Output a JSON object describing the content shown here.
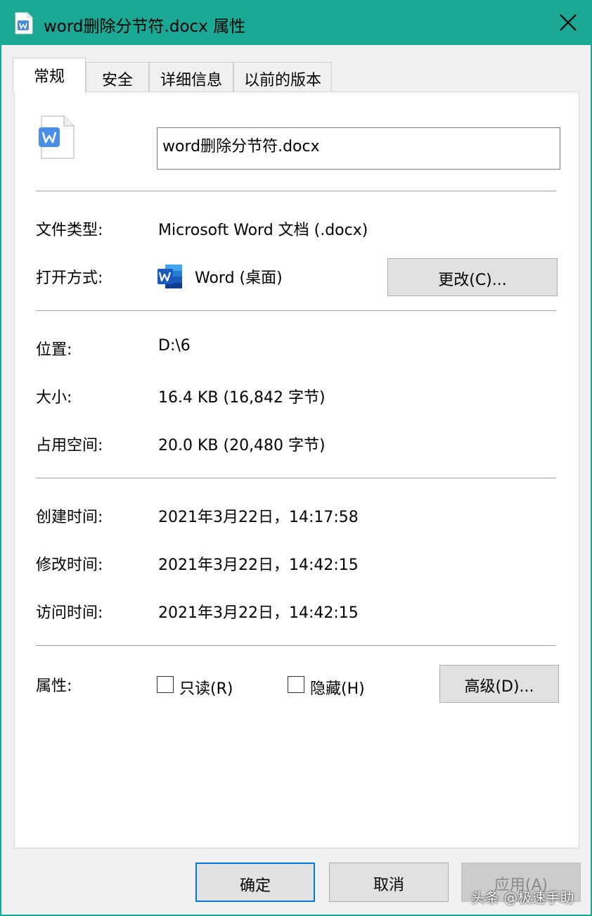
{
  "window": {
    "title": "word删除分节符.docx 属性",
    "accent_color": "#1aa794"
  },
  "tabs": [
    {
      "label": "常规",
      "active": true
    },
    {
      "label": "安全",
      "active": false
    },
    {
      "label": "详细信息",
      "active": false
    },
    {
      "label": "以前的版本",
      "active": false
    }
  ],
  "general": {
    "file_name": "word删除分节符.docx",
    "file_icon": "wps-document-icon",
    "file_type_label": "文件类型:",
    "file_type_value": "Microsoft Word 文档 (.docx)",
    "open_with_label": "打开方式:",
    "open_with_value": "Word (桌面)",
    "open_with_icon": "word-app-icon",
    "change_button": "更改(C)...",
    "location_label": "位置:",
    "location_value": "D:\\6",
    "size_label": "大小:",
    "size_value": "16.4 KB (16,842 字节)",
    "disk_size_label": "占用空间:",
    "disk_size_value": "20.0 KB (20,480 字节)",
    "created_label": "创建时间:",
    "created_value": "2021年3月22日，14:17:58",
    "modified_label": "修改时间:",
    "modified_value": "2021年3月22日，14:42:15",
    "accessed_label": "访问时间:",
    "accessed_value": "2021年3月22日，14:42:15",
    "attributes_label": "属性:",
    "readonly_label": "只读(R)",
    "readonly_checked": false,
    "hidden_label": "隐藏(H)",
    "hidden_checked": false,
    "advanced_button": "高级(D)..."
  },
  "footer": {
    "ok": "确定",
    "cancel": "取消",
    "apply": "应用(A)"
  },
  "watermark": "头条 @极速手助"
}
